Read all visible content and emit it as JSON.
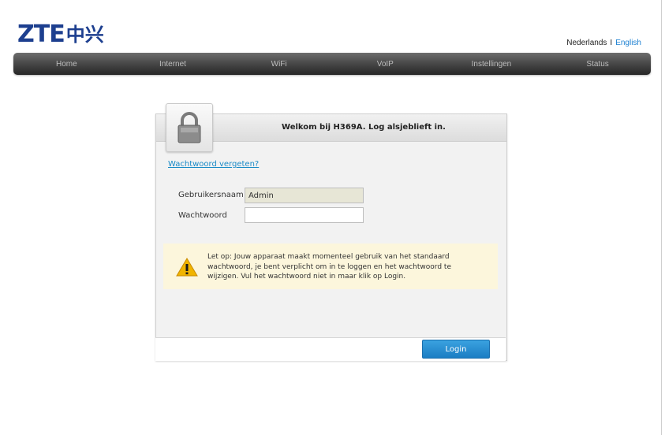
{
  "brand": {
    "logo_latin": "ZTE",
    "logo_cn": "中兴"
  },
  "language": {
    "dutch": "Nederlands",
    "separator": "I",
    "english": "English"
  },
  "nav": {
    "items": [
      "Home",
      "Internet",
      "WiFi",
      "VoIP",
      "Instellingen",
      "Status"
    ]
  },
  "login": {
    "title": "Welkom bij H369A. Log alsjeblieft in.",
    "forgot_link": "Wachtwoord vergeten?",
    "username_label": "Gebruikersnaam",
    "username_value": "Admin",
    "password_label": "Wachtwoord",
    "password_value": "",
    "warning": "Let op: Jouw apparaat maakt momenteel gebruik van het standaard wachtwoord, je bent verplicht om in te loggen en het wachtwoord te wijzigen. Vul het wachtwoord niet in maar klik op Login.",
    "button_label": "Login"
  },
  "colors": {
    "brand_blue": "#1d3f8f",
    "link_blue": "#1a8bc7",
    "button_blue": "#2a90d2",
    "warning_bg": "#fcf6dc"
  },
  "icons": {
    "lock": "lock-icon",
    "warning": "warning-icon"
  }
}
